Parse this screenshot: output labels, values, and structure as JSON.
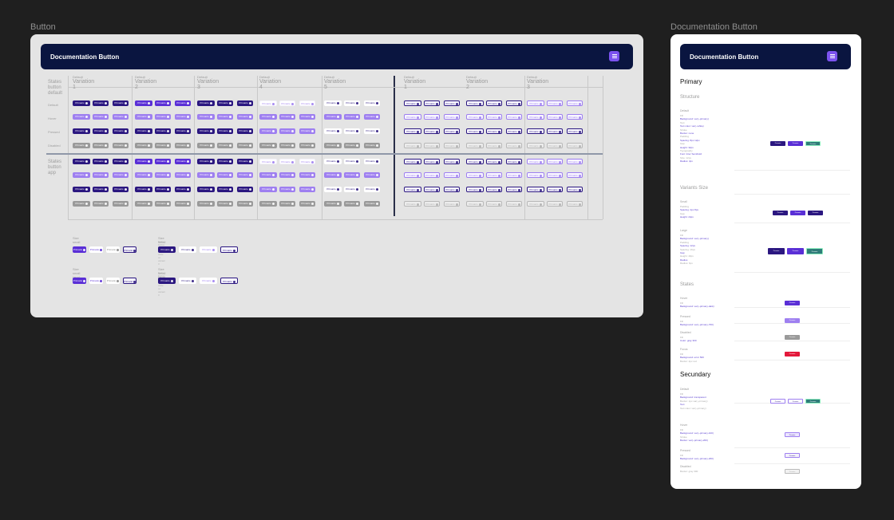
{
  "frames": {
    "button_label": "Button",
    "doc_label": "Documentation Button"
  },
  "hero_title": "Documentation  Button",
  "column_headers": [
    {
      "small": "Default",
      "big": "Variation 1"
    },
    {
      "small": "Default",
      "big": "Variation 2"
    },
    {
      "small": "Default",
      "big": "Variation 3"
    },
    {
      "small": "Default",
      "big": "Variation 4"
    },
    {
      "small": "Default",
      "big": "Variation 5"
    },
    {
      "small": "Default",
      "big": "Variation 1"
    },
    {
      "small": "Default",
      "big": "Variation 2"
    },
    {
      "small": "Default",
      "big": "Variation 3"
    }
  ],
  "groups": [
    "States button default",
    "States button app"
  ],
  "row_labels": [
    "Default",
    "Hover",
    "Pressed",
    "Disabled"
  ],
  "button_text": "Primario",
  "bottom_groups": [
    {
      "title": "Size small",
      "sub": ""
    },
    {
      "title": "Size small",
      "sub": "Note: button with light state on variant 3"
    },
    {
      "title": "Size small (app)",
      "sub": ""
    },
    {
      "title": "Size small (app)",
      "sub": "Note: button with light state on variant 3"
    }
  ],
  "doc": {
    "primary": "Primary",
    "structure": "Structure",
    "variants_size": "Variants Size",
    "states": "States",
    "secundary": "Secundary",
    "blocks": [
      {
        "section": "Default",
        "lines": [
          "Fill",
          "Background: var(--primary)",
          "Text",
          "Text color: var(--white)",
          "Stroke",
          "Border: none",
          "Padding",
          "Spacing: 8px 12px",
          "Gap",
          "Height: 32px",
          "Typography",
          "Font: Inter Semibold",
          "Size: 12px",
          "Radius: 4px"
        ]
      },
      {
        "section": "Small",
        "lines": [
          "Padding",
          "Spacing: 4px 8px",
          "Gap",
          "Height: 24px"
        ]
      },
      {
        "section": "Large",
        "lines": [
          "Fill",
          "Background: var(--primary)",
          "Padding",
          "Spacing: 12px",
          "Spacing: 16px",
          "Gap",
          "Height: 40px",
          "Radius",
          "Radius: 6px"
        ]
      },
      {
        "section": "Hover",
        "lines": [
          "Fill",
          "Background: var(--primary-dark)"
        ]
      },
      {
        "section": "Pressed",
        "lines": [
          "Fill",
          "Background: var(--primary-700)"
        ]
      },
      {
        "section": "Disabled",
        "lines": [
          "Fill",
          "Color: gray 300"
        ]
      },
      {
        "section": "Focus",
        "lines": [
          "Fill",
          "Background: error 500",
          "Border: 2px red"
        ]
      },
      {
        "section": "Default",
        "lines": [
          "Fill",
          "Background: transparent",
          "Border: 1px var(--primary)",
          "Text",
          "Text color: var(--primary)"
        ]
      },
      {
        "section": "Hover",
        "lines": [
          "Fill",
          "Background: var(--primary-100)",
          "Stroke",
          "Border: var(--primary-200)"
        ]
      },
      {
        "section": "Pressed",
        "lines": [
          "Fill",
          "Background: var(--primary-200)"
        ]
      },
      {
        "section": "Disabled",
        "lines": [
          "Border: gray 300"
        ]
      }
    ]
  },
  "colors": {
    "dark_primary": "#2b1780",
    "primary": "#5a2fd6",
    "light_primary": "#9e7ff0",
    "pale": "#f4f2fb",
    "disabled": "#9a9a9a",
    "navy": "#0a1540",
    "accent": "#7b52ef",
    "error": "#e3183a",
    "teal": "#2f7d79"
  }
}
